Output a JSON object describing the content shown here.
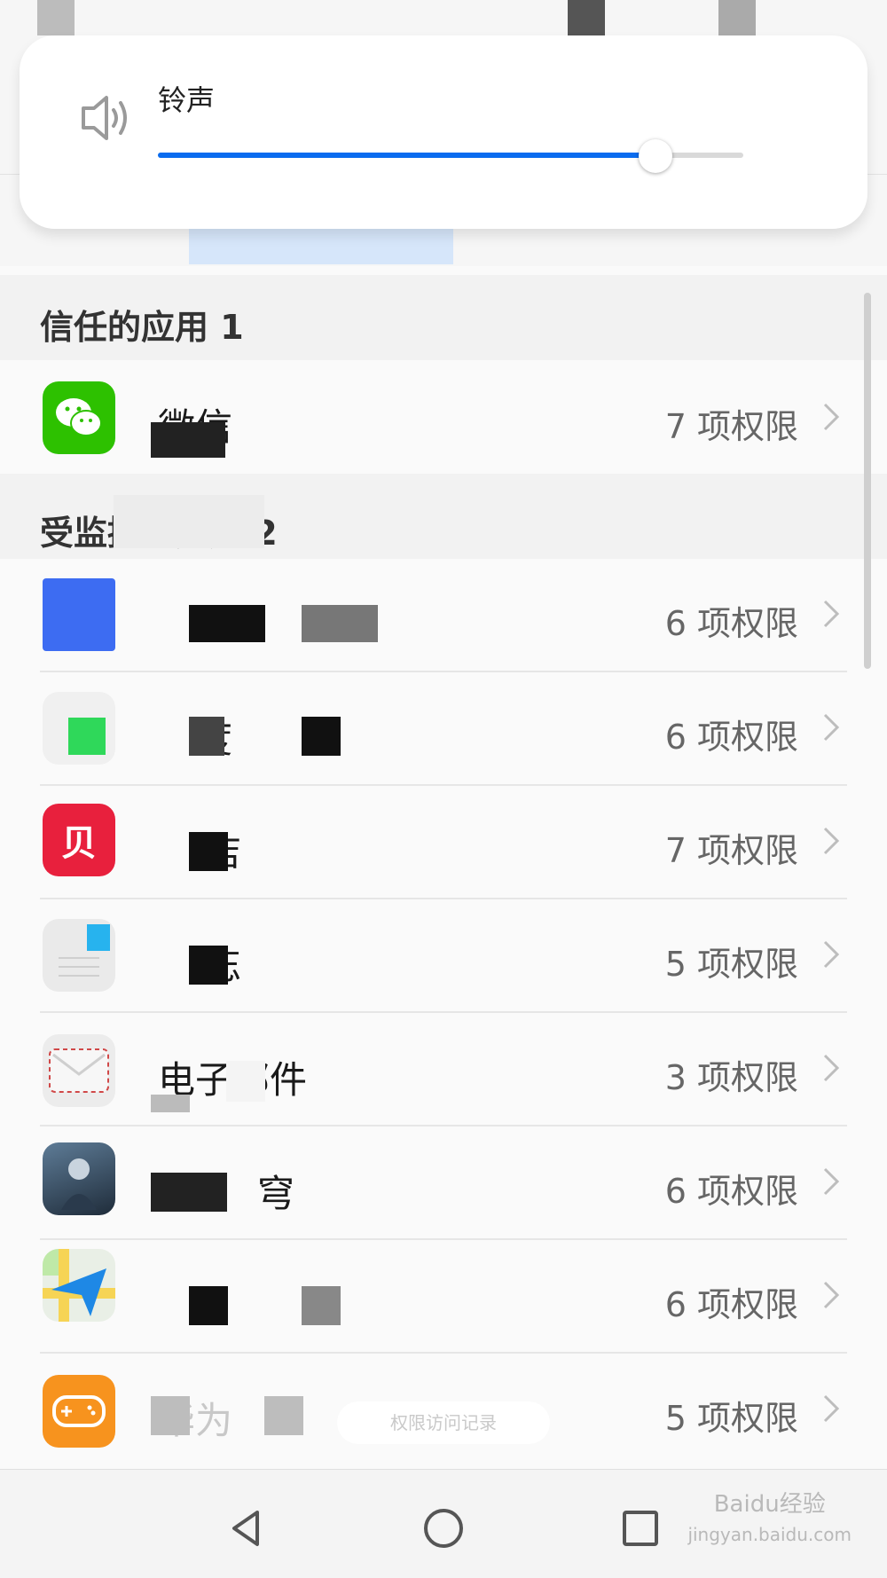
{
  "volume_panel": {
    "label": "铃声",
    "level_fraction": 0.85,
    "icon": "speaker-icon",
    "accent_color": "#0a6cef"
  },
  "sections": {
    "trusted": {
      "title": "信任的应用 1"
    },
    "monitored": {
      "title": "受监控的应用 2"
    }
  },
  "apps": [
    {
      "name": "微信",
      "permissions": "7 项权限",
      "icon": "wechat-icon"
    },
    {
      "name": "",
      "permissions": "6 项权限",
      "icon": "app-icon-blue"
    },
    {
      "name": "度",
      "permissions": "6 项权限",
      "icon": "app-icon-green"
    },
    {
      "name": "店",
      "permissions": "7 项权限",
      "icon": "app-icon-red"
    },
    {
      "name": "忘",
      "permissions": "5 项权限",
      "icon": "memo-icon"
    },
    {
      "name": "电子邮件",
      "permissions": "3 项权限",
      "icon": "mail-icon"
    },
    {
      "name": "穹",
      "permissions": "6 项权限",
      "icon": "game-icon"
    },
    {
      "name": "",
      "permissions": "6 项权限",
      "icon": "map-icon"
    },
    {
      "name": "华为",
      "permissions": "5 项权限",
      "icon": "gamepad-icon"
    }
  ],
  "toast": {
    "text": "权限访问记录"
  },
  "navbar": {
    "back": "back-icon",
    "home": "home-icon",
    "recent": "recent-icon"
  },
  "watermark": {
    "line1": "Baidu经验",
    "line2": "jingyan.baidu.com"
  }
}
